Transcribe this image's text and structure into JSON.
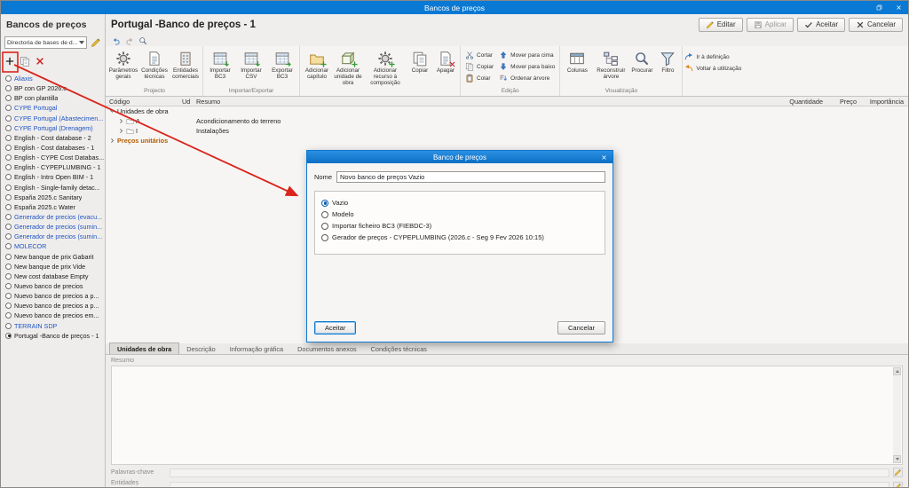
{
  "window": {
    "title": "Bancos de preços"
  },
  "colors": {
    "titlebar": "#0a79d3",
    "accent": "#0b79d2",
    "link_blue": "#1f55c4",
    "item_black": "#1a1a1a",
    "unit_orange": "#b25c00",
    "annotation_red": "#d9251d"
  },
  "sidebar": {
    "title": "Bancos de preços",
    "directory": {
      "value": "Directoria de bases de d..."
    },
    "items": [
      {
        "label": "Aliaxis",
        "color": "#1f55c4"
      },
      {
        "label": "BP con GP 2026.c",
        "color": "#1a1a1a"
      },
      {
        "label": "BP con plantilla",
        "color": "#1a1a1a"
      },
      {
        "label": "CYPE Portugal",
        "color": "#1f55c4"
      },
      {
        "label": "CYPE Portugal (Abastecimen...",
        "color": "#1f55c4"
      },
      {
        "label": "CYPE Portugal (Drenagem)",
        "color": "#1f55c4"
      },
      {
        "label": "English - Cost database - 2",
        "color": "#1a1a1a"
      },
      {
        "label": "English - Cost databases - 1",
        "color": "#1a1a1a"
      },
      {
        "label": "English - CYPE Cost Databas...",
        "color": "#1a1a1a"
      },
      {
        "label": "English - CYPEPLUMBING - 1",
        "color": "#1a1a1a"
      },
      {
        "label": "English - Intro Open BIM - 1",
        "color": "#1a1a1a"
      },
      {
        "label": "English - Single-family detac...",
        "color": "#1a1a1a"
      },
      {
        "label": "España 2025.c Sanitary",
        "color": "#1a1a1a"
      },
      {
        "label": "España 2025.c Water",
        "color": "#1a1a1a"
      },
      {
        "label": "Generador de precios (evacu...",
        "color": "#1f55c4"
      },
      {
        "label": "Generador de precios (sumin...",
        "color": "#1f55c4"
      },
      {
        "label": "Generador de precios (sumin...",
        "color": "#1f55c4"
      },
      {
        "label": "MOLECOR",
        "color": "#1f55c4"
      },
      {
        "label": "New banque de prix Gabarit",
        "color": "#1a1a1a"
      },
      {
        "label": "New banque de prix Vide",
        "color": "#1a1a1a"
      },
      {
        "label": "New cost database Empty",
        "color": "#1a1a1a"
      },
      {
        "label": "Nuevo banco de precios",
        "color": "#1a1a1a"
      },
      {
        "label": "Nuevo banco de precios a p...",
        "color": "#1a1a1a"
      },
      {
        "label": "Nuevo banco de precios a p...",
        "color": "#1a1a1a"
      },
      {
        "label": "Nuevo banco de precios em...",
        "color": "#1a1a1a"
      },
      {
        "label": "TERRAIN SDP",
        "color": "#1f55c4"
      },
      {
        "label": "Portugal -Banco de preços - 1",
        "color": "#1a1a1a",
        "selected": true
      }
    ]
  },
  "header": {
    "title": "Portugal -Banco de preços - 1",
    "buttons": [
      {
        "label": "Editar"
      },
      {
        "label": "Aplicar",
        "disabled": true
      },
      {
        "label": "Aceitar"
      },
      {
        "label": "Cancelar"
      }
    ]
  },
  "toolbar": {
    "groups": {
      "projecto": {
        "label": "Projecto",
        "items": [
          "Parâmetros gerais",
          "Condições técnicas",
          "Entidades comerciais"
        ]
      },
      "importar": {
        "label": "Importar/Exportar",
        "items": [
          "Importar BC3",
          "Importar CSV",
          "Exportar BC3"
        ]
      },
      "adicionar": {
        "label": "",
        "items": [
          "Adicionar capítulo",
          "Adicionar unidade de obra",
          "Adicionar recurso à composição",
          "Copiar",
          "Apagar"
        ]
      },
      "edicao": {
        "label": "Edição",
        "clipboard": [
          "Cortar",
          "Copiar",
          "Colar"
        ],
        "move": [
          "Mover para cima",
          "Mover para baixo",
          "Ordenar árvore"
        ]
      },
      "visualizacao": {
        "label": "Visualização",
        "items": [
          "Colunas",
          "Reconstruir árvore",
          "Procurar",
          "Filtro"
        ]
      },
      "navegacao": {
        "items": [
          "Ir à definição",
          "Voltar à utilização"
        ]
      }
    }
  },
  "table": {
    "columns": [
      "Código",
      "Ud",
      "Resumo",
      "Quantidade",
      "Preço",
      "Importância"
    ],
    "rows": [
      {
        "code": "Unidades de obra",
        "ud": "",
        "resumo": "",
        "quantidade": "",
        "preco": "",
        "importancia": ""
      },
      {
        "code": "A",
        "ud": "",
        "resumo": "Acondicionamento do terreno",
        "quantidade": "",
        "preco": "",
        "importancia": ""
      },
      {
        "code": "I",
        "ud": "",
        "resumo": "Instalações",
        "quantidade": "",
        "preco": "",
        "importancia": ""
      },
      {
        "code": "Preços unitários",
        "ud": "",
        "resumo": "",
        "quantidade": "",
        "preco": "",
        "importancia": ""
      }
    ]
  },
  "dialog": {
    "title": "Banco de preços",
    "name_label": "Nome",
    "name_value": "Novo banco de preços Vazio",
    "options": [
      {
        "label": "Vazio",
        "selected": true
      },
      {
        "label": "Modelo",
        "selected": false
      },
      {
        "label": "Importar ficheiro BC3 (FIEBDC-3)",
        "selected": false
      },
      {
        "label": "Gerador de preços - CYPEPLUMBING (2026.c - Seg  9 Fev 2026  10:15)",
        "selected": false
      }
    ],
    "accept_label": "Aceitar",
    "cancel_label": "Cancelar"
  },
  "bottom": {
    "tabs": [
      {
        "label": "Unidades de obra",
        "active": true
      },
      {
        "label": "Descrição",
        "active": false
      },
      {
        "label": "Informação gráfica",
        "active": false
      },
      {
        "label": "Documentos anexos",
        "active": false
      },
      {
        "label": "Condições técnicas",
        "active": false
      }
    ],
    "resumo_label": "Resumo",
    "keywords_label": "Palavras-chave",
    "entities_label": "Entidades comerciais"
  }
}
